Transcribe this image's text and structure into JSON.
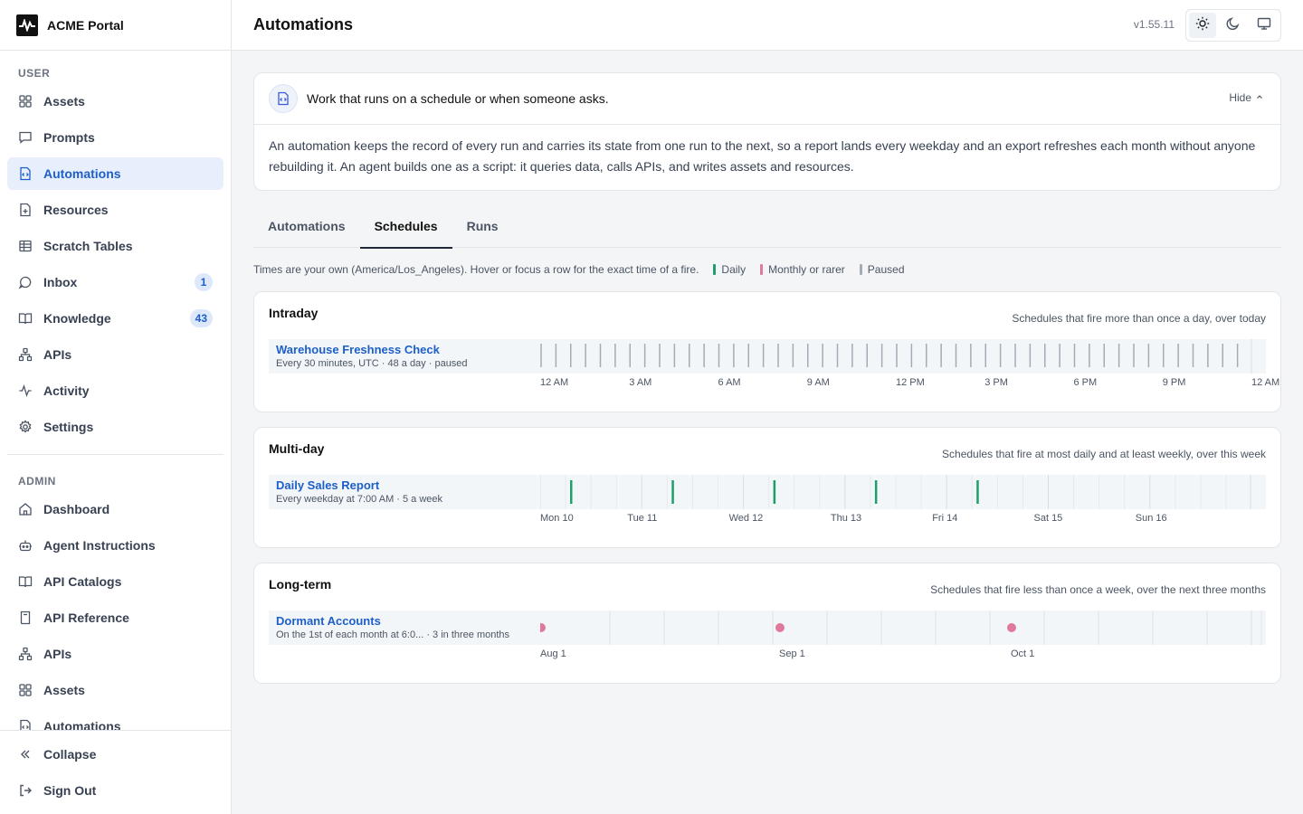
{
  "app": {
    "name": "ACME Portal",
    "version": "v1.55.11"
  },
  "header": {
    "title": "Automations"
  },
  "sidebar": {
    "user_label": "USER",
    "user_items": [
      {
        "label": "Assets",
        "icon": "grid-icon"
      },
      {
        "label": "Prompts",
        "icon": "message-square-icon"
      },
      {
        "label": "Automations",
        "icon": "file-code-icon",
        "active": true
      },
      {
        "label": "Resources",
        "icon": "file-plus-icon"
      },
      {
        "label": "Scratch Tables",
        "icon": "table-icon"
      },
      {
        "label": "Inbox",
        "icon": "message-circle-icon",
        "badge": "1"
      },
      {
        "label": "Knowledge",
        "icon": "book-open-icon",
        "badge": "43"
      },
      {
        "label": "APIs",
        "icon": "network-icon"
      },
      {
        "label": "Activity",
        "icon": "activity-icon"
      },
      {
        "label": "Settings",
        "icon": "gear-icon"
      }
    ],
    "admin_label": "ADMIN",
    "admin_items": [
      {
        "label": "Dashboard",
        "icon": "home-icon"
      },
      {
        "label": "Agent Instructions",
        "icon": "bot-icon"
      },
      {
        "label": "API Catalogs",
        "icon": "book-open-icon"
      },
      {
        "label": "API Reference",
        "icon": "book-icon"
      },
      {
        "label": "APIs",
        "icon": "network-icon"
      },
      {
        "label": "Assets",
        "icon": "grid-icon"
      },
      {
        "label": "Automations",
        "icon": "file-code-icon"
      }
    ],
    "footer": {
      "collapse": "Collapse",
      "sign_out": "Sign Out"
    }
  },
  "theme": {
    "options": [
      "light",
      "dark",
      "system"
    ],
    "selected": "light"
  },
  "info": {
    "title": "Work that runs on a schedule or when someone asks.",
    "hide_label": "Hide",
    "body": "An automation keeps the record of every run and carries its state from one run to the next, so a report lands every weekday and an export refreshes each month without anyone rebuilding it. An agent builds one as a script: it queries data, calls APIs, and writes assets and resources."
  },
  "tabs": [
    {
      "label": "Automations",
      "active": false
    },
    {
      "label": "Schedules",
      "active": true
    },
    {
      "label": "Runs",
      "active": false
    }
  ],
  "legend": {
    "note": "Times are your own (America/Los_Angeles). Hover or focus a row for the exact time of a fire.",
    "items": [
      {
        "label": "Daily",
        "color": "#1f9d6b"
      },
      {
        "label": "Monthly or rarer",
        "color": "#e07a9c"
      },
      {
        "label": "Paused",
        "color": "#a4abb6"
      }
    ]
  },
  "sections": [
    {
      "title": "Intraday",
      "subtitle": "Schedules that fire more than once a day, over today",
      "row": {
        "name": "Warehouse Freshness Check",
        "meta": "Every 30 minutes, UTC · 48 a day · paused",
        "status": "paused",
        "fires_per_day": 48
      },
      "axis": [
        "12 AM",
        "3 AM",
        "6 AM",
        "9 AM",
        "12 PM",
        "3 PM",
        "6 PM",
        "9 PM",
        "12 AM"
      ]
    },
    {
      "title": "Multi-day",
      "subtitle": "Schedules that fire at most daily and at least weekly, over this week",
      "row": {
        "name": "Daily Sales Report",
        "meta": "Every weekday at 7:00 AM · 5 a week",
        "status": "daily",
        "fire_days": [
          0,
          1,
          2,
          3,
          4
        ],
        "fire_hour": 7
      },
      "axis": [
        "Mon 10",
        "Tue 11",
        "Wed 12",
        "Thu 13",
        "Fri 14",
        "Sat 15",
        "Sun 16"
      ]
    },
    {
      "title": "Long-term",
      "subtitle": "Schedules that fire less than once a week, over the next three months",
      "row": {
        "name": "Dormant Accounts",
        "meta": "On the 1st of each month at 6:0... · 3 in three months",
        "status": "monthly",
        "fire_months": [
          0,
          1,
          2
        ]
      },
      "axis": [
        "Aug 1",
        "Sep 1",
        "Oct 1"
      ]
    }
  ]
}
